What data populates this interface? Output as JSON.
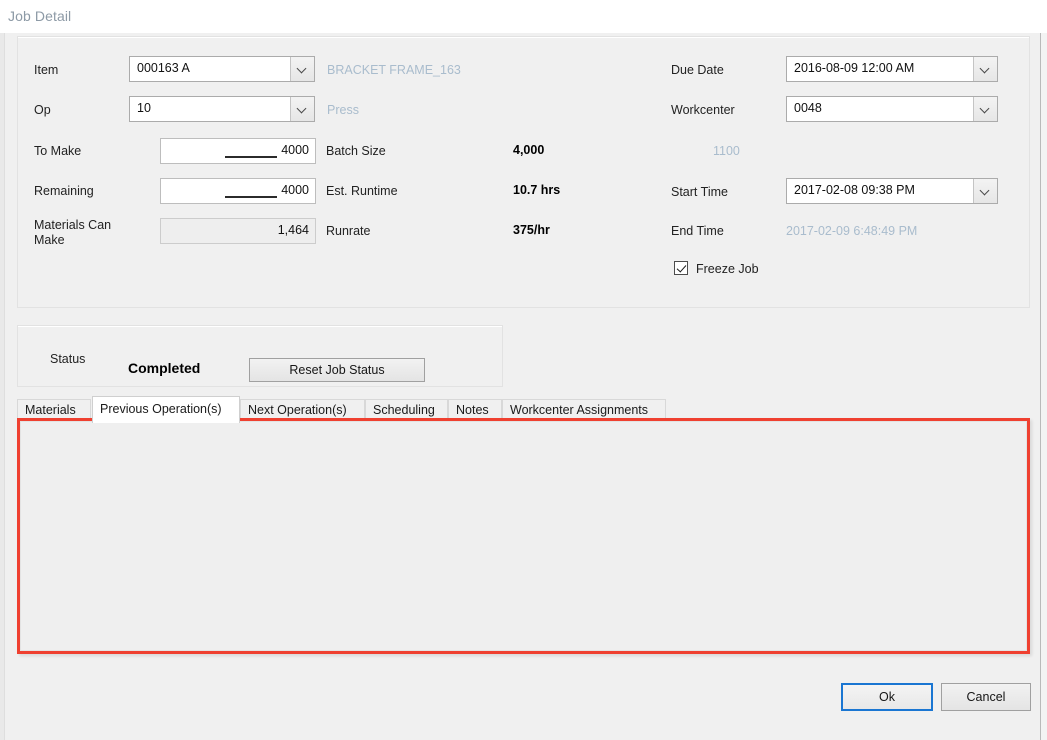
{
  "window": {
    "title": "Job Detail"
  },
  "main_panel": {
    "item": {
      "label": "Item",
      "value": "000163 A",
      "description": "BRACKET FRAME_163"
    },
    "op": {
      "label": "Op",
      "value": "10",
      "description": "Press"
    },
    "to_make": {
      "label": "To Make",
      "value": "4000"
    },
    "remaining": {
      "label": "Remaining",
      "value": "4000"
    },
    "materials_can_make": {
      "label": "Materials Can Make",
      "label_line1": "Materials Can",
      "label_line2": "Make",
      "value": "1,464"
    },
    "batch_size": {
      "label": "Batch Size",
      "value": "4,000"
    },
    "est_runtime": {
      "label": "Est. Runtime",
      "value": "10.7 hrs"
    },
    "runrate": {
      "label": "Runrate",
      "value": "375/hr"
    },
    "due_date": {
      "label": "Due Date",
      "value": "2016-08-09 12:00 AM"
    },
    "workcenter": {
      "label": "Workcenter",
      "value": "0048",
      "description": "1100"
    },
    "start_time": {
      "label": "Start Time",
      "value": "2017-02-08 09:38 PM"
    },
    "end_time": {
      "label": "End Time",
      "value": "2017-02-09 6:48:49 PM"
    },
    "freeze_job": {
      "label": "Freeze Job",
      "checked": true
    }
  },
  "status_panel": {
    "label": "Status",
    "value": "Completed",
    "reset_button": "Reset Job Status"
  },
  "tabs": {
    "selected_index": 1,
    "items": [
      {
        "label": "Materials"
      },
      {
        "label": "Previous Operation(s)"
      },
      {
        "label": "Next Operation(s)"
      },
      {
        "label": "Scheduling"
      },
      {
        "label": "Notes"
      },
      {
        "label": "Workcenter Assignments"
      }
    ]
  },
  "footer": {
    "ok_label": "Ok",
    "cancel_label": "Cancel"
  },
  "colors": {
    "highlight": "#ef4030",
    "focus_border": "#1a76d2",
    "muted_text": "#a9bccd",
    "window_background": "#f0f0f0"
  },
  "icons": {
    "dropdown": "chevron-down-icon",
    "checkbox_checked": "checkmark-icon"
  }
}
